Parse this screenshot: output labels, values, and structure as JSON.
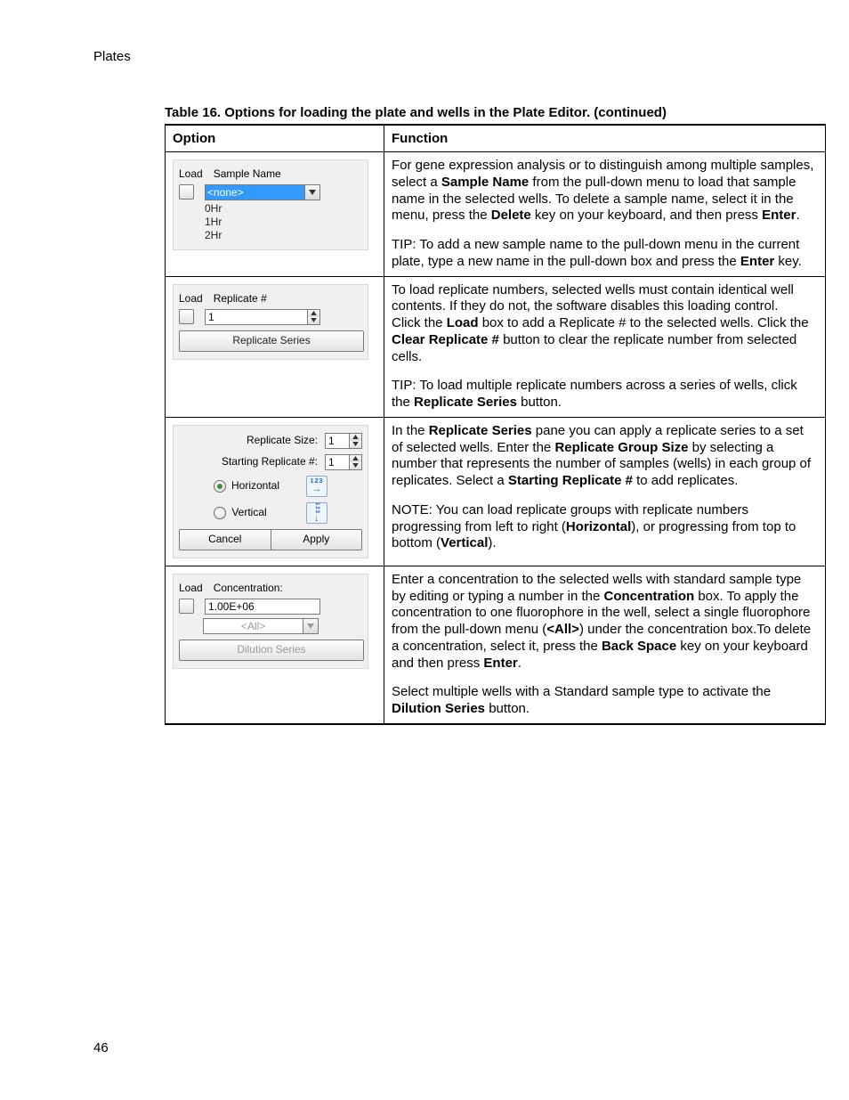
{
  "header": {
    "running": "Plates",
    "pagenum": "46"
  },
  "caption": "Table 16. Options for loading the plate and wells in the Plate Editor. (continued)",
  "th": {
    "option": "Option",
    "function": "Function"
  },
  "row_sample": {
    "load": "Load",
    "label": "Sample Name",
    "selected": "<none>",
    "opts": [
      "0Hr",
      "1Hr",
      "2Hr"
    ],
    "func1a": "For gene expression analysis or to distinguish among multiple samples, select a ",
    "func1b": "Sample Name",
    "func1c": " from the pull-down menu to load that sample name in the selected wells. To delete a sample name, select it in the menu, press the ",
    "func1d": "Delete",
    "func1e": " key on your keyboard, and then press ",
    "func1f": "Enter",
    "func1g": ".",
    "tip_a": "TIP: To add a new sample name to the pull-down menu in the current plate, type a new name in the pull-down box and press the ",
    "tip_b": "Enter",
    "tip_c": " key."
  },
  "row_rep": {
    "load": "Load",
    "label": "Replicate #",
    "value": "1",
    "btn": "Replicate Series",
    "f1a": "To load replicate numbers, selected wells must contain identical well contents. If they do not, the software disables this loading control.",
    "f2a": "Click the ",
    "f2b": "Load",
    "f2c": " box to add a Replicate # to the selected wells. Click the ",
    "f2d": "Clear Replicate #",
    "f2e": " button to clear the replicate number from selected cells.",
    "tip_a": "TIP: To load multiple replicate numbers across a series of wells, click the ",
    "tip_b": "Replicate Series",
    "tip_c": " button."
  },
  "row_series": {
    "size_label": "Replicate Size:",
    "size_val": "1",
    "start_label": "Starting Replicate #:",
    "start_val": "1",
    "horiz": "Horizontal",
    "vert": "Vertical",
    "cancel": "Cancel",
    "apply": "Apply",
    "f1a": "In the ",
    "f1b": "Replicate Series",
    "f1c": " pane you can apply a replicate series to a set of selected wells. Enter the ",
    "f1d": "Replicate Group Size",
    "f1e": " by selecting a number that represents the number of samples (wells) in each group of replicates. Select a ",
    "f1f": "Starting Replicate #",
    "f1g": " to add replicates.",
    "f2a": "NOTE: You can load replicate groups with replicate numbers progressing from left to right (",
    "f2b": "Horizontal",
    "f2c": "), or progressing from top to bottom (",
    "f2d": "Vertical",
    "f2e": ")."
  },
  "row_conc": {
    "load": "Load",
    "label": "Concentration:",
    "value": "1.00E+06",
    "allsel": "<All>",
    "btn": "Dilution Series",
    "p1a": "Enter a concentration to the selected wells with standard sample type by editing or typing a number in the ",
    "p1b": "Concentration",
    "p1c": " box. To apply the concentration to one fluorophore in the well, select a single fluorophore from the pull-down menu (",
    "p1d": "<All>",
    "p1e": ") under the concentration box.To delete a concentration, select it, press the ",
    "p1f": "Back Space",
    "p1g": " key on your keyboard and then press ",
    "p1h": "Enter",
    "p1i": ".",
    "p2a": "Select multiple wells with a Standard sample type to activate the ",
    "p2b": "Dilution Series",
    "p2c": " button."
  }
}
